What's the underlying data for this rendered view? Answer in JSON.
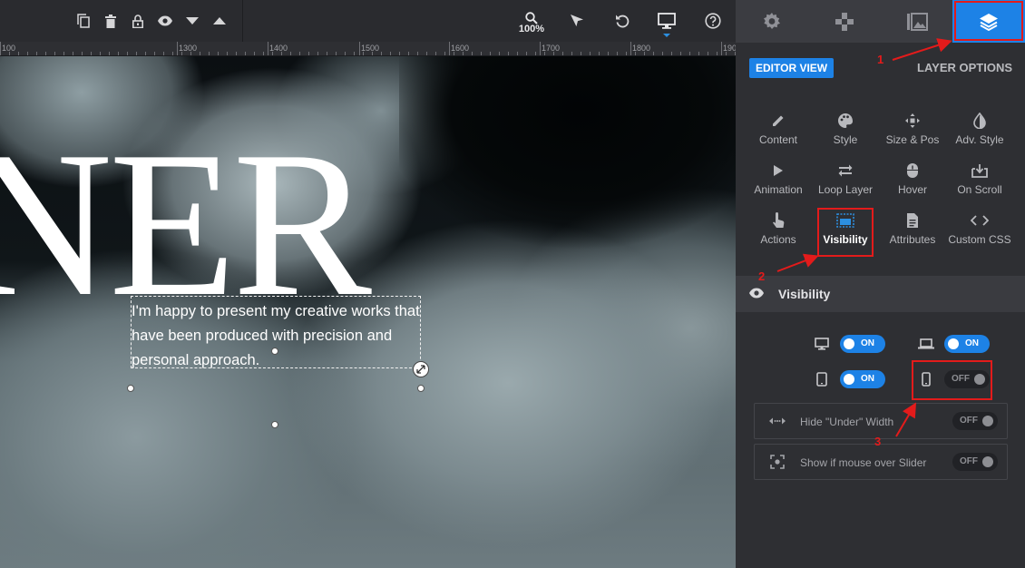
{
  "toolbar": {
    "zoom_level": "100%",
    "icons": [
      "copy-icon",
      "delete-icon",
      "lock-icon",
      "eye-icon",
      "arrow-down-icon",
      "arrow-up-icon",
      "zoom-icon",
      "pointer-icon",
      "undo-icon",
      "desktop-icon",
      "help-icon"
    ]
  },
  "ruler": {
    "labels": [
      "100",
      "1300",
      "1400",
      "1500",
      "1600",
      "1700",
      "1800",
      "190"
    ]
  },
  "canvas": {
    "headline": "NER",
    "body_text": "I'm happy to present my creative works that have been produced with precision and personal approach."
  },
  "panel": {
    "tabs": [
      "settings-icon",
      "navigation-icon",
      "media-icon",
      "layers-icon"
    ],
    "editor_view": "EDITOR VIEW",
    "layer_options": "LAYER OPTIONS",
    "options": [
      {
        "label": "Content",
        "icon": "pencil-icon"
      },
      {
        "label": "Style",
        "icon": "palette-icon"
      },
      {
        "label": "Size & Pos",
        "icon": "move-icon"
      },
      {
        "label": "Adv. Style",
        "icon": "contrast-icon"
      },
      {
        "label": "Animation",
        "icon": "play-icon"
      },
      {
        "label": "Loop Layer",
        "icon": "loop-icon"
      },
      {
        "label": "Hover",
        "icon": "mouse-icon"
      },
      {
        "label": "On Scroll",
        "icon": "scroll-icon"
      },
      {
        "label": "Actions",
        "icon": "hand-icon"
      },
      {
        "label": "Visibility",
        "icon": "visibility-icon"
      },
      {
        "label": "Attributes",
        "icon": "document-icon"
      },
      {
        "label": "Custom CSS",
        "icon": "code-icon"
      }
    ],
    "visibility": {
      "title": "Visibility",
      "desktop": "ON",
      "notebook": "ON",
      "tablet": "ON",
      "mobile": "OFF",
      "hide_under_label": "Hide \"Under\" Width",
      "hide_under_value": "OFF",
      "show_mouse_label": "Show if mouse over Slider",
      "show_mouse_value": "OFF"
    }
  },
  "annotations": {
    "step1": "1",
    "step2": "2",
    "step3": "3",
    "color": "#e31b1b"
  },
  "colors": {
    "accent": "#1d82e6",
    "panel_bg": "#2e2f33"
  }
}
